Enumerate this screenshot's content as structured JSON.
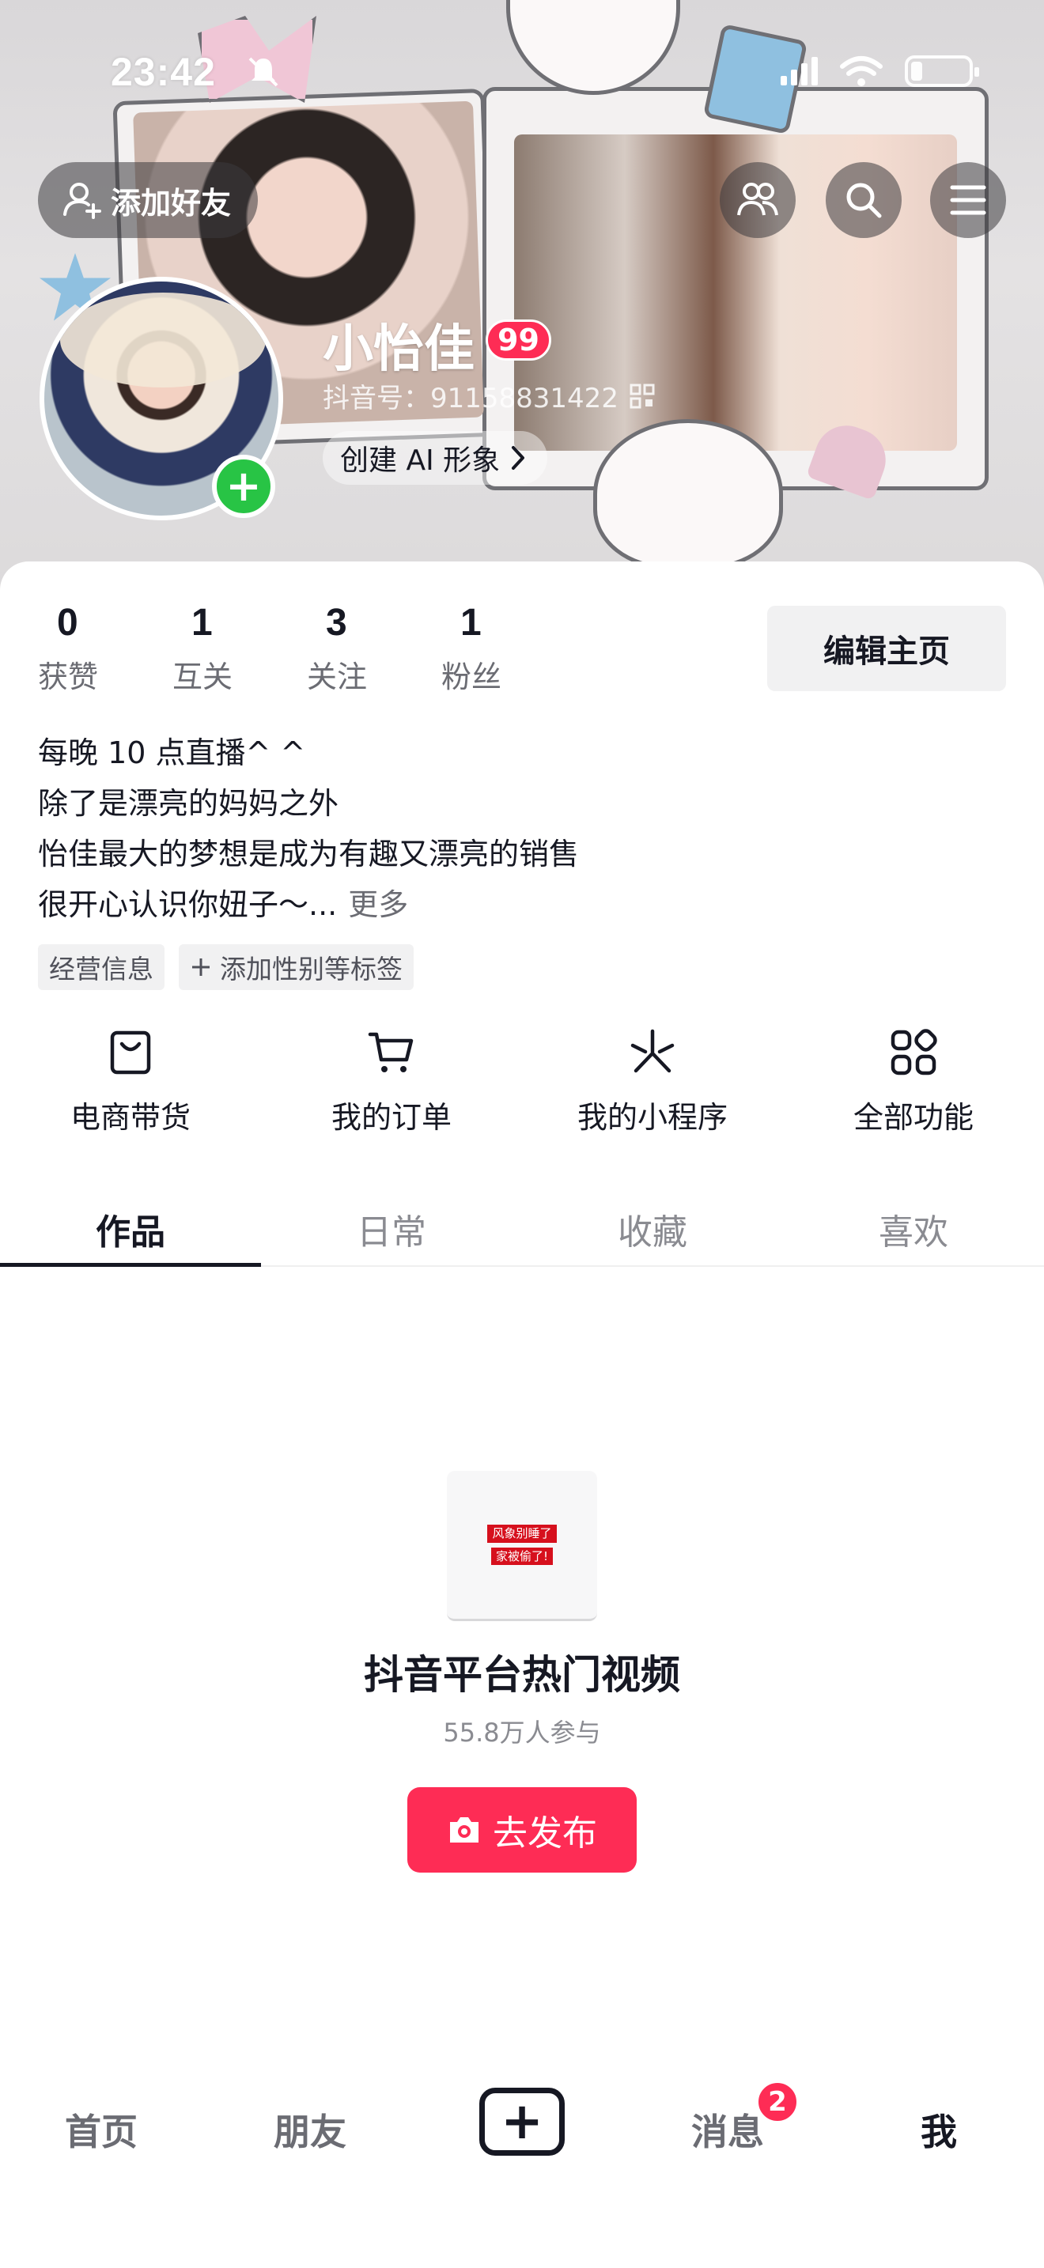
{
  "status_bar": {
    "time": "23:42"
  },
  "header": {
    "add_friend_label": "添加好友",
    "name": "小怡佳",
    "level": "99",
    "douyin_id": "抖音号：91158831422",
    "ai_button_label": "创建 AI 形象"
  },
  "stats": [
    {
      "value": "0",
      "label": "获赞"
    },
    {
      "value": "1",
      "label": "互关"
    },
    {
      "value": "3",
      "label": "关注"
    },
    {
      "value": "1",
      "label": "粉丝"
    }
  ],
  "edit_profile_label": "编辑主页",
  "bio": {
    "lines": [
      "每晚 10 点直播^ ^",
      "除了是漂亮的妈妈之外",
      "怡佳最大的梦想是成为有趣又漂亮的销售",
      "很开心认识你妞子～..."
    ],
    "more": "更多"
  },
  "tags": [
    "经营信息",
    "添加性别等标签"
  ],
  "features": [
    {
      "label": "电商带货",
      "icon": "shopping-bag-icon"
    },
    {
      "label": "我的订单",
      "icon": "cart-icon"
    },
    {
      "label": "我的小程序",
      "icon": "mini-program-icon"
    },
    {
      "label": "全部功能",
      "icon": "grid-icon"
    }
  ],
  "tabs": [
    "作品",
    "日常",
    "收藏",
    "喜欢"
  ],
  "active_tab": "作品",
  "empty_state": {
    "thumb_line1": "风象别睡了",
    "thumb_line2": "家被偷了!",
    "title": "抖音平台热门视频",
    "subtitle": "55.8万人参与",
    "publish_label": "去发布"
  },
  "bottom_nav": {
    "home": "首页",
    "friends": "朋友",
    "messages": "消息",
    "messages_badge": "2",
    "me": "我"
  },
  "colors": {
    "accent": "#fe2c55",
    "green": "#28c445",
    "text": "#161823"
  }
}
